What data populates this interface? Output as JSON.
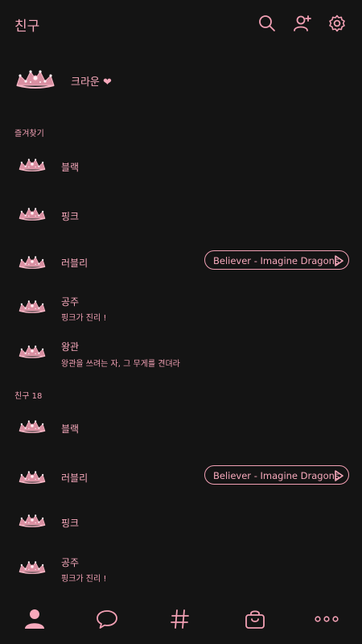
{
  "header": {
    "title": "친구",
    "icons": [
      "search-icon",
      "add-friend-icon",
      "settings-icon"
    ]
  },
  "me": {
    "name": "크라운 ❤"
  },
  "favorites": {
    "label": "즐겨찾기",
    "items": [
      {
        "name": "블랙",
        "status": "",
        "music": ""
      },
      {
        "name": "핑크",
        "status": "",
        "music": ""
      },
      {
        "name": "러블리",
        "status": "",
        "music": "Believer - Imagine Dragons"
      },
      {
        "name": "공주",
        "status": "핑크가 진리 !",
        "music": ""
      },
      {
        "name": "왕관",
        "status": "왕관을 쓰려는 자, 그 무게를 견뎌라",
        "music": ""
      }
    ]
  },
  "friends": {
    "label": "친구 18",
    "items": [
      {
        "name": "블랙",
        "status": "",
        "music": ""
      },
      {
        "name": "러블리",
        "status": "",
        "music": "Believer - Imagine Dragons"
      },
      {
        "name": "핑크",
        "status": "",
        "music": ""
      },
      {
        "name": "공주",
        "status": "핑크가 진리 !",
        "music": ""
      }
    ]
  },
  "tabbar": {
    "tabs": [
      "person-icon",
      "chat-bubble-icon",
      "hashtag-icon",
      "shopping-bag-icon",
      "more-icon"
    ]
  },
  "colors": {
    "background": "#141414",
    "accent": "#f2a0b4"
  }
}
